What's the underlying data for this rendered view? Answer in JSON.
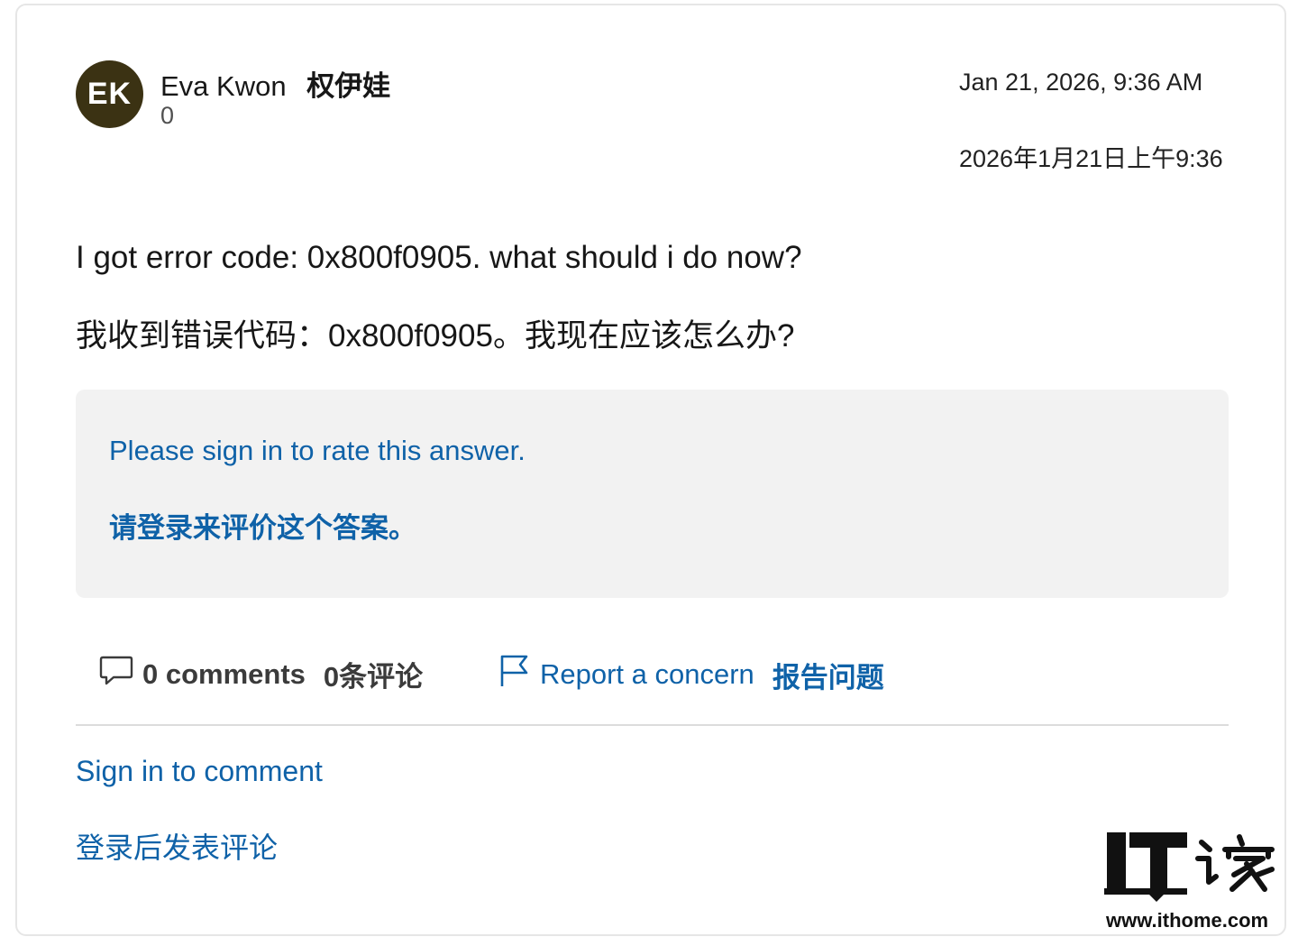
{
  "author": {
    "initials": "EK",
    "name_en": "Eva Kwon",
    "name_cn": "权伊娃",
    "reputation": "0"
  },
  "timestamp": {
    "en": "Jan 21, 2026, 9:36 AM",
    "cn": "2026年1月21日上午9:36"
  },
  "body": {
    "en": "I got error code: 0x800f0905. what should i do now?",
    "cn": "我收到错误代码：0x800f0905。我现在应该怎么办?"
  },
  "rate_box": {
    "en": "Please sign in to rate this answer.",
    "cn": "请登录来评价这个答案。"
  },
  "actions": {
    "comments_en": "0 comments",
    "comments_cn": "0条评论",
    "report_en": "Report a concern",
    "report_cn": "报告问题"
  },
  "sign_in": {
    "en": "Sign in to comment",
    "cn": "登录后发表评论"
  },
  "watermark": {
    "url": "www.ithome.com"
  },
  "colors": {
    "link": "#0f62a8",
    "avatar_bg": "#3b3213",
    "rate_box_bg": "#f2f2f2"
  }
}
